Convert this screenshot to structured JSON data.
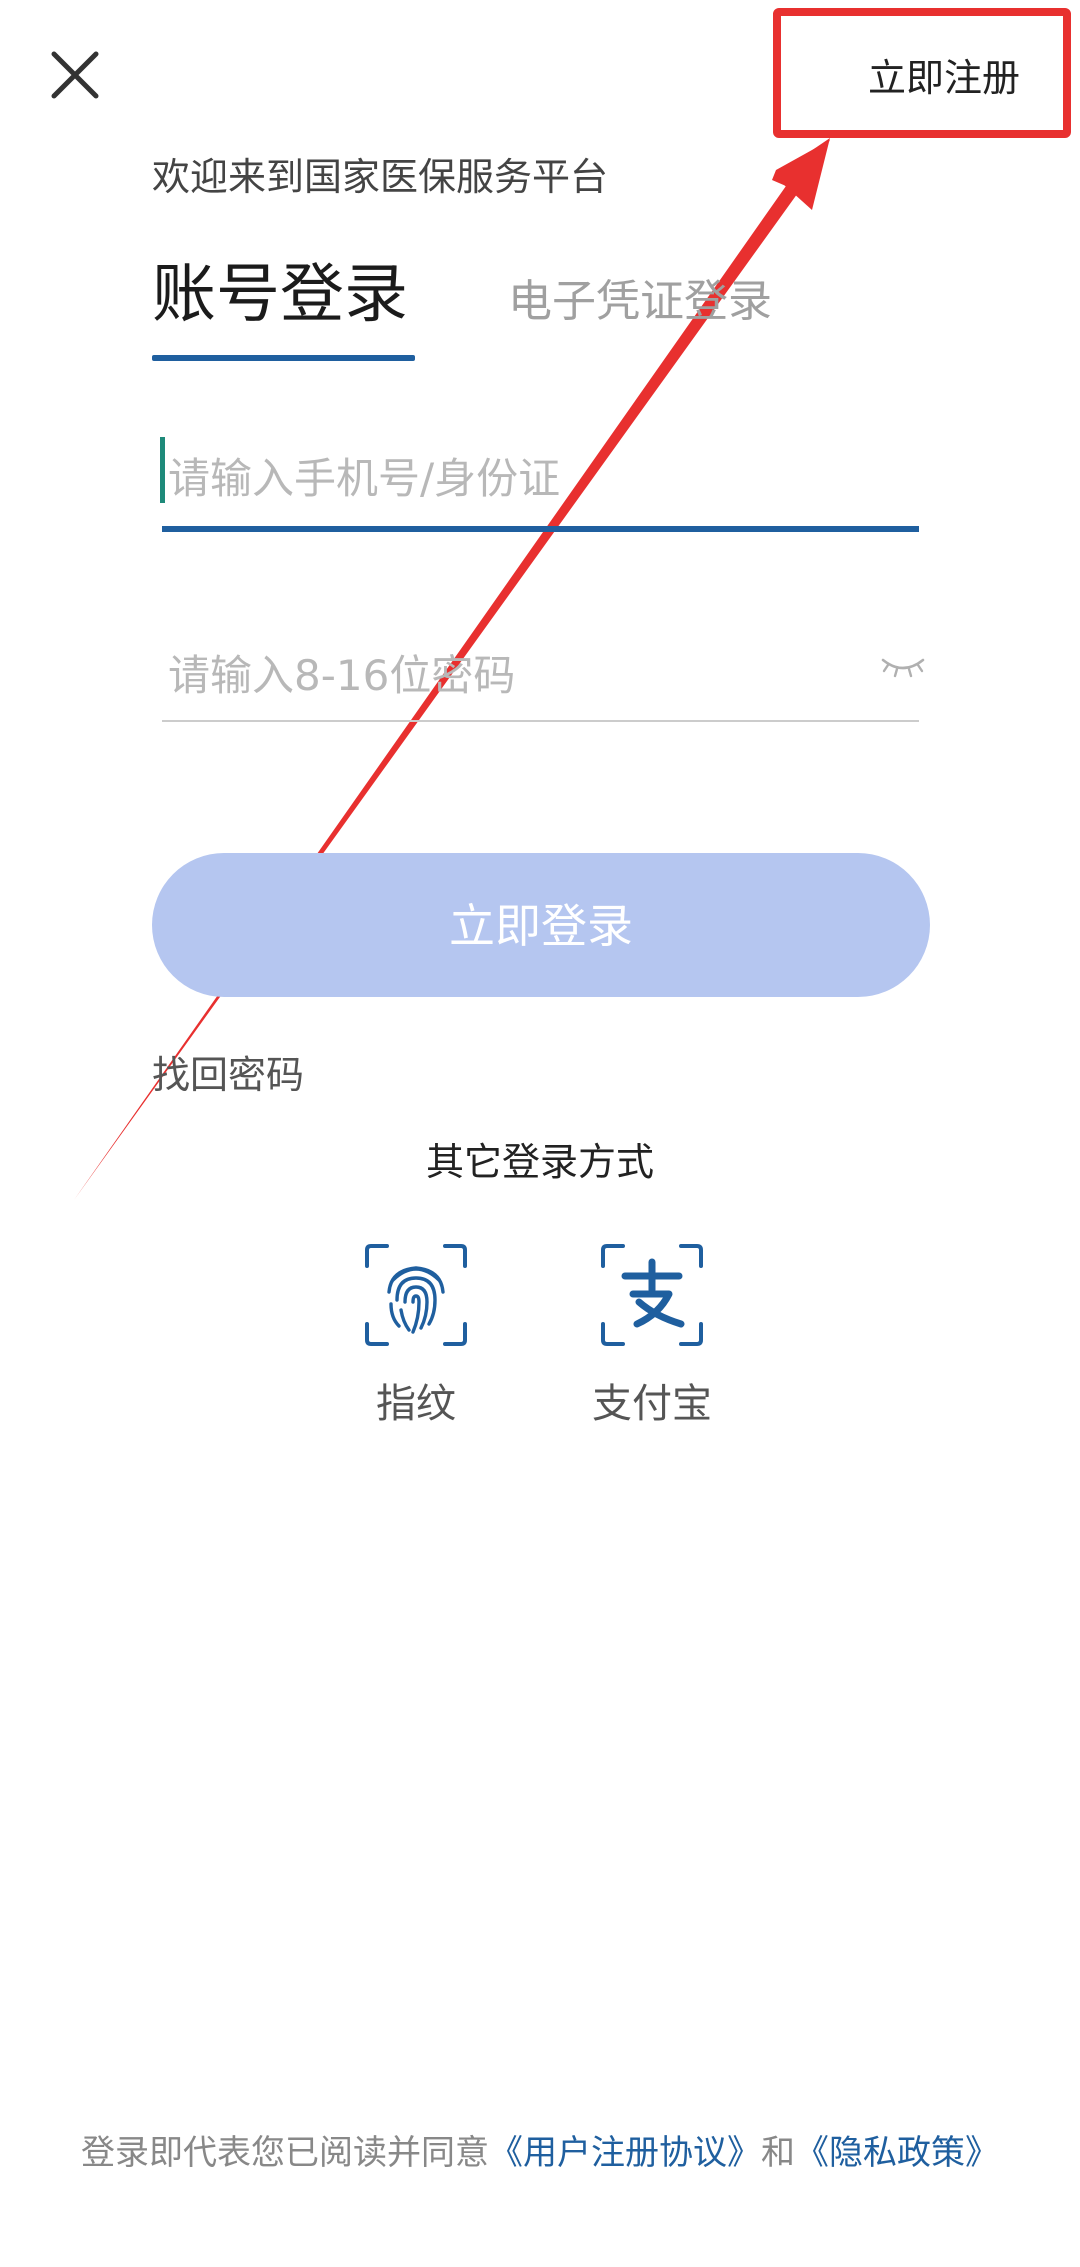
{
  "header": {
    "close_icon": "close-icon",
    "register_label": "立即注册"
  },
  "welcome_text": "欢迎来到国家医保服务平台",
  "tabs": [
    {
      "label": "账号登录",
      "active": true
    },
    {
      "label": "电子凭证登录",
      "active": false
    }
  ],
  "form": {
    "phone_placeholder": "请输入手机号/身份证",
    "phone_value": "",
    "password_placeholder": "请输入8-16位密码",
    "password_value": "",
    "password_toggle_icon": "eye-closed-icon"
  },
  "login_button_label": "立即登录",
  "forgot_password_label": "找回密码",
  "other_login": {
    "title": "其它登录方式",
    "options": [
      {
        "label": "指纹",
        "icon": "fingerprint-icon"
      },
      {
        "label": "支付宝",
        "icon": "alipay-icon"
      }
    ]
  },
  "footer": {
    "prefix": "登录即代表您已阅读并同意",
    "user_agreement": "《用户注册协议》",
    "connector": "和",
    "privacy_policy": "《隐私政策》"
  },
  "colors": {
    "accent": "#1f5f9f",
    "login_button": "#b5c6f0",
    "annotation_red": "#e8302f"
  }
}
